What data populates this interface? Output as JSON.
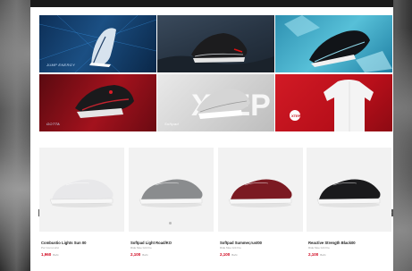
{
  "banners": [
    {
      "caption": "JUMP ENERGY",
      "theme": "blue-tech"
    },
    {
      "caption": "",
      "theme": "dark-rock"
    },
    {
      "caption": "",
      "theme": "cyan-ice"
    },
    {
      "caption": "GOTTA",
      "theme": "red-dark"
    },
    {
      "caption": "Softpad",
      "watermark": "XTEP",
      "theme": "light-grey"
    },
    {
      "caption": "",
      "theme": "red-apparel",
      "logo": "XTEP"
    }
  ],
  "products": [
    {
      "name": "Combustio Lights Sun 00",
      "sub": "Por Como Hrst",
      "price": "1,960",
      "currency": "Baht",
      "shoe_color": "#e8e8ea"
    },
    {
      "name": "Softpad Light Road/KO",
      "sub": "Ride Moe Grit Fre",
      "price": "2,100",
      "currency": "Baht",
      "shoe_color": "#8a8c8e"
    },
    {
      "name": "Softpad Summer,rust00",
      "sub": "Ride Moe Grit Fre",
      "price": "2,100",
      "currency": "Baht",
      "shoe_color": "#7b1a22"
    },
    {
      "name": "Reactive Strength Black00",
      "sub": "Ride Moe Grit Fre",
      "price": "2,100",
      "currency": "Baht",
      "shoe_color": "#1a1a1c"
    }
  ],
  "carousel": {
    "prev": "‹",
    "next": "›"
  }
}
